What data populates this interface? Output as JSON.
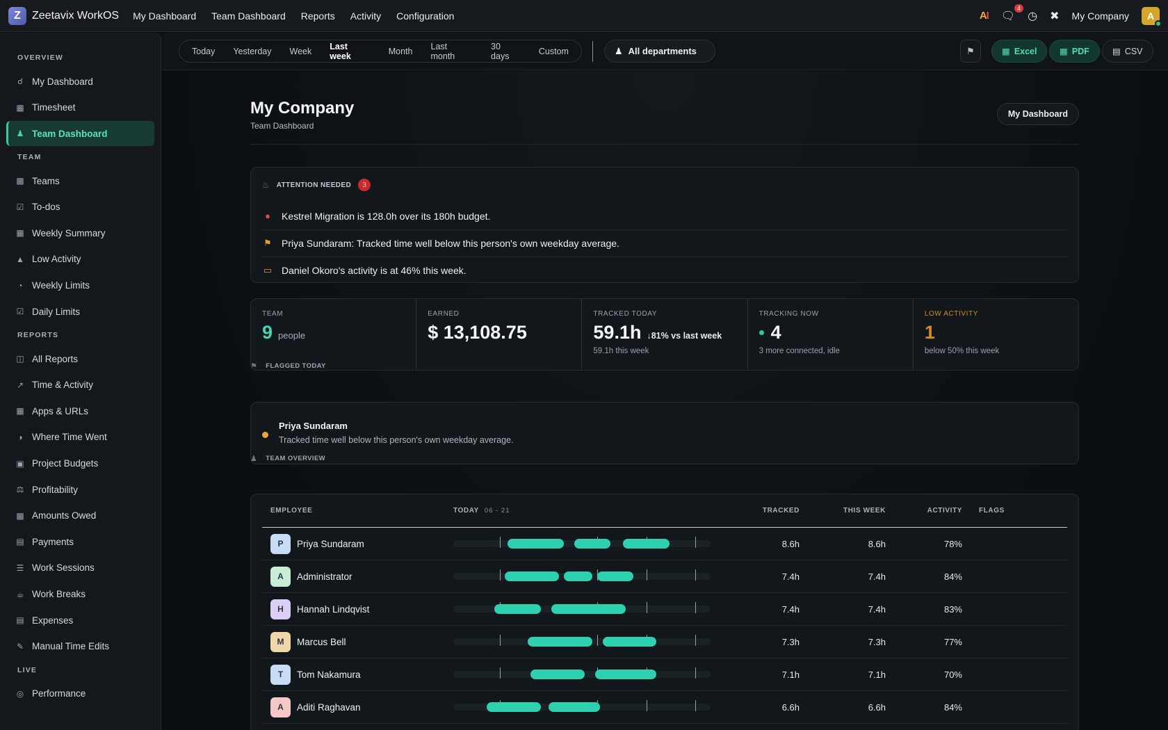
{
  "app": {
    "logo_letter": "Z",
    "name": "Zeetavix WorkOS"
  },
  "topnav": {
    "links": [
      "My Dashboard",
      "Team Dashboard",
      "Reports",
      "Activity",
      "Configuration"
    ],
    "ai_label": "AI",
    "chat_badge": "4",
    "company": "My Company",
    "avatar_letter": "A",
    "icons": [
      "ai-icon",
      "chat-icon",
      "clock-icon",
      "tools-icon"
    ]
  },
  "sidebar": {
    "sections": [
      {
        "title": "OVERVIEW",
        "items": [
          {
            "label": "My Dashboard",
            "icon": "lock-icon"
          },
          {
            "label": "Timesheet",
            "icon": "calendar-icon"
          },
          {
            "label": "Team Dashboard",
            "icon": "users-icon",
            "active": true
          }
        ]
      },
      {
        "title": "TEAM",
        "items": [
          {
            "label": "Teams",
            "icon": "sitemap-icon"
          },
          {
            "label": "To-dos",
            "icon": "checkbox-icon"
          },
          {
            "label": "Weekly Summary",
            "icon": "table-icon"
          },
          {
            "label": "Low Activity",
            "icon": "warning-icon"
          },
          {
            "label": "Weekly Limits",
            "icon": "gauge-icon"
          },
          {
            "label": "Daily Limits",
            "icon": "calendar-check-icon"
          }
        ]
      },
      {
        "title": "REPORTS",
        "items": [
          {
            "label": "All Reports",
            "icon": "folder-icon"
          },
          {
            "label": "Time & Activity",
            "icon": "line-chart-icon"
          },
          {
            "label": "Apps & URLs",
            "icon": "grid-icon"
          },
          {
            "label": "Where Time Went",
            "icon": "pie-chart-icon"
          },
          {
            "label": "Project Budgets",
            "icon": "briefcase-icon"
          },
          {
            "label": "Profitability",
            "icon": "scale-icon"
          },
          {
            "label": "Amounts Owed",
            "icon": "money-icon"
          },
          {
            "label": "Payments",
            "icon": "credit-card-icon"
          },
          {
            "label": "Work Sessions",
            "icon": "list-icon"
          },
          {
            "label": "Work Breaks",
            "icon": "coffee-icon"
          },
          {
            "label": "Expenses",
            "icon": "receipt-icon"
          },
          {
            "label": "Manual Time Edits",
            "icon": "edit-icon"
          }
        ]
      },
      {
        "title": "LIVE",
        "items": [
          {
            "label": "Performance",
            "icon": "target-icon"
          }
        ]
      }
    ]
  },
  "filters": {
    "ranges": [
      "Today",
      "Yesterday",
      "Week",
      "Last week",
      "Month",
      "Last month",
      "30 days",
      "Custom"
    ],
    "active_range": "Last week",
    "department": "All departments",
    "exports": [
      "Excel",
      "PDF",
      "CSV"
    ]
  },
  "page": {
    "title": "My Company",
    "subtitle": "Team Dashboard",
    "head_button": "My Dashboard"
  },
  "attention": {
    "label": "ATTENTION NEEDED",
    "count": "3",
    "items": [
      {
        "text": "Kestrel Migration is 128.0h over its 180h budget.",
        "icon": "alert-circle-icon",
        "color": "#e04848"
      },
      {
        "text": "Priya Sundaram: Tracked time well below this person's own weekday average.",
        "icon": "flag-icon",
        "color": "#f0a020"
      },
      {
        "text": "Daniel Okoro's activity is at 46% this week.",
        "icon": "battery-low-icon",
        "color": "#e0912a"
      }
    ]
  },
  "kpis": {
    "team": {
      "label": "TEAM",
      "value": "9",
      "unit": "people"
    },
    "earned": {
      "label": "EARNED",
      "value": "$ 13,108.75"
    },
    "tracked": {
      "label": "TRACKED TODAY",
      "value": "59.1h",
      "delta": "81% vs last week",
      "sub": "59.1h this week"
    },
    "tracking_now": {
      "label": "TRACKING NOW",
      "value": "4",
      "sub": "3 more connected, idle"
    },
    "low_activity": {
      "label": "LOW ACTIVITY",
      "value": "1",
      "sub": "below 50% this week"
    }
  },
  "flagged": {
    "label": "FLAGGED TODAY",
    "name": "Priya Sundaram",
    "message": "Tracked time well below this person's own weekday average."
  },
  "overview": {
    "label": "TEAM OVERVIEW",
    "headers": {
      "employee": "EMPLOYEE",
      "today": "TODAY",
      "date": "06 - 21",
      "tracked": "TRACKED",
      "week": "THIS WEEK",
      "activity": "ACTIVITY",
      "flags": "FLAGS"
    },
    "rows": [
      {
        "initial": "P",
        "name": "Priya Sundaram",
        "color": "#c9dcf5",
        "tracked": "8.6h",
        "week": "8.6h",
        "activity": "78%",
        "segments": [
          [
            0.21,
            0.43
          ],
          [
            0.47,
            0.61
          ],
          [
            0.66,
            0.84
          ]
        ]
      },
      {
        "initial": "A",
        "name": "Administrator",
        "color": "#c9ecd6",
        "tracked": "7.4h",
        "week": "7.4h",
        "activity": "84%",
        "segments": [
          [
            0.2,
            0.41
          ],
          [
            0.43,
            0.54
          ],
          [
            0.56,
            0.7
          ]
        ]
      },
      {
        "initial": "H",
        "name": "Hannah Lindqvist",
        "color": "#dccff5",
        "tracked": "7.4h",
        "week": "7.4h",
        "activity": "83%",
        "segments": [
          [
            0.16,
            0.34
          ],
          [
            0.38,
            0.67
          ]
        ]
      },
      {
        "initial": "M",
        "name": "Marcus Bell",
        "color": "#f2d7ab",
        "tracked": "7.3h",
        "week": "7.3h",
        "activity": "77%",
        "segments": [
          [
            0.29,
            0.54
          ],
          [
            0.58,
            0.79
          ]
        ]
      },
      {
        "initial": "T",
        "name": "Tom Nakamura",
        "color": "#c9dcf5",
        "tracked": "7.1h",
        "week": "7.1h",
        "activity": "70%",
        "segments": [
          [
            0.3,
            0.51
          ],
          [
            0.55,
            0.79
          ]
        ]
      },
      {
        "initial": "A",
        "name": "Aditi Raghavan",
        "color": "#f5c7c7",
        "tracked": "6.6h",
        "week": "6.6h",
        "activity": "84%",
        "segments": [
          [
            0.13,
            0.34
          ],
          [
            0.37,
            0.57
          ]
        ]
      }
    ]
  },
  "colors": {
    "accent": "#2fd0b0",
    "danger": "#e04848",
    "warning": "#f0a020",
    "amber": "#d68b1f"
  }
}
